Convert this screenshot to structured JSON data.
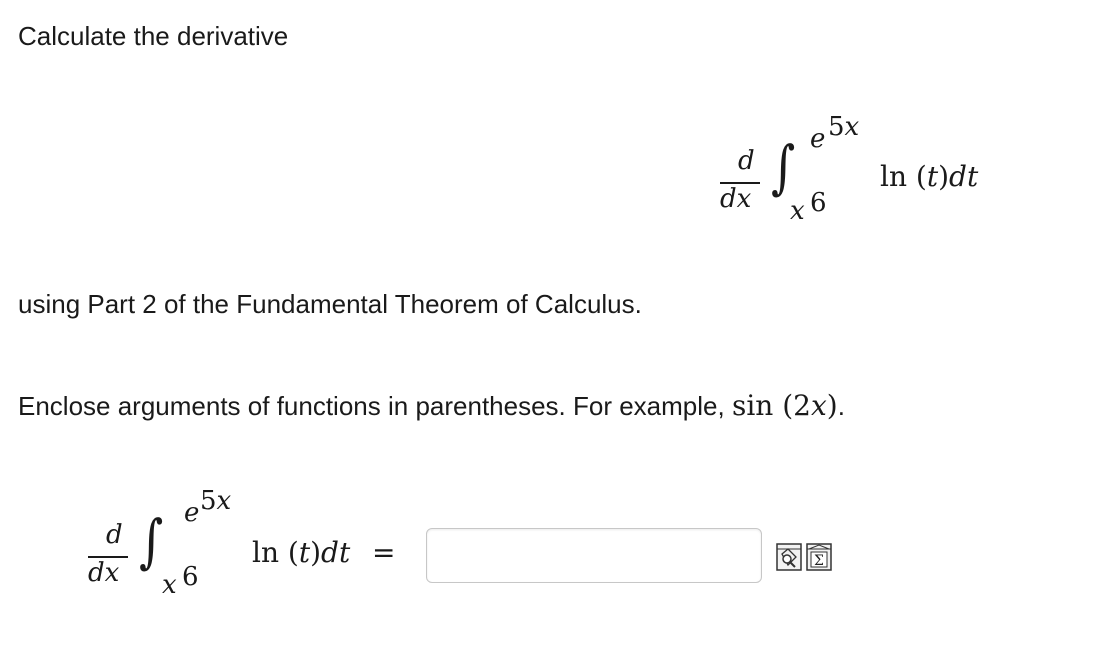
{
  "prompt": {
    "line1": "Calculate the derivative",
    "line2": "using Part 2 of the Fundamental Theorem of Calculus.",
    "line3_prefix": "Enclose arguments of functions in parentheses. For example,",
    "line3_example": "sin (2x)",
    "line3_suffix": "."
  },
  "expression": {
    "d": "d",
    "dx": "dx",
    "integral_sign": "∫",
    "upper_base": "e",
    "upper_exp": "5x",
    "lower_base": "x",
    "lower_exp": "6",
    "integrand_fn": "ln",
    "integrand_arg": "(t)",
    "integrand_diff": "dt",
    "equals": "="
  },
  "answer": {
    "value": ""
  },
  "tools": {
    "preview_icon": "preview-icon",
    "equation_editor_icon": "equation-editor-icon",
    "equation_editor_glyph": "Σ"
  }
}
